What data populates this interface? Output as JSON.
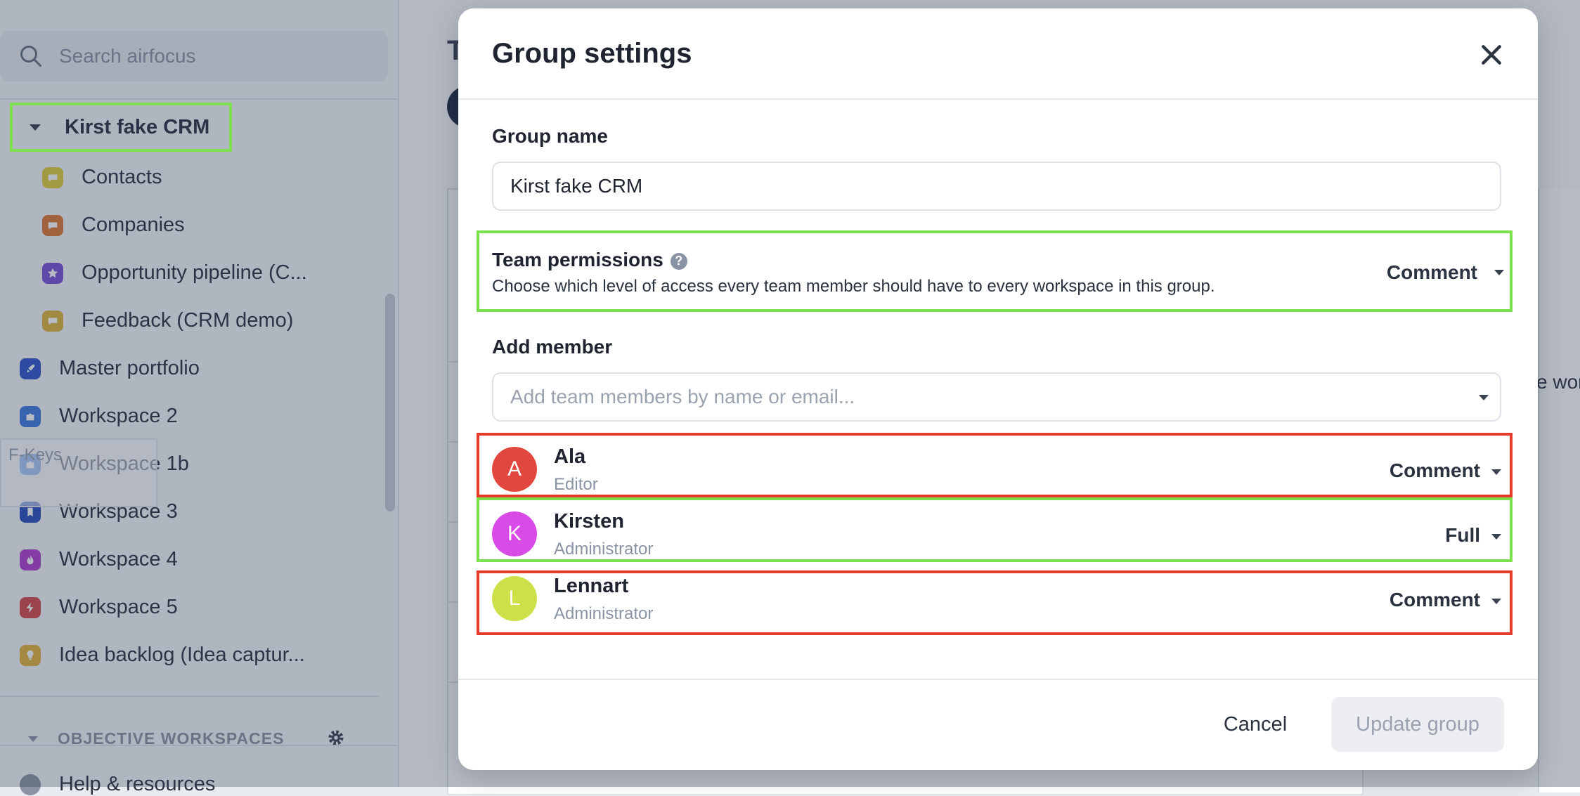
{
  "sidebar": {
    "search_placeholder": "Search airfocus",
    "group": {
      "label": "Kirst fake CRM"
    },
    "group_items": [
      {
        "label": "Contacts",
        "color": "#e3cf3a"
      },
      {
        "label": "Companies",
        "color": "#e07a35"
      },
      {
        "label": "Opportunity pipeline (C...",
        "color": "#7a52d6"
      },
      {
        "label": "Feedback (CRM demo)",
        "color": "#e0b53a"
      }
    ],
    "workspaces": [
      {
        "label": "Master portfolio",
        "color": "#2f55c9"
      },
      {
        "label": "Workspace 2",
        "color": "#3f7ae0"
      },
      {
        "label": "Workspace 1b",
        "color": "#4b8ae6"
      },
      {
        "label": "Workspace 3",
        "color": "#2a4ebd"
      },
      {
        "label": "Workspace 4",
        "color": "#b23fce"
      },
      {
        "label": "Workspace 5",
        "color": "#d6494a"
      },
      {
        "label": "Idea backlog (Idea captur...",
        "color": "#e3b43a"
      }
    ],
    "fkeys_label": "F-Keys",
    "objective_heading": "OBJECTIVE WORKSPACES",
    "help_label": "Help & resources"
  },
  "main": {
    "title_fragment": "T",
    "right_text_fragment": "e wor"
  },
  "modal": {
    "title": "Group settings",
    "group_name_label": "Group name",
    "group_name_value": "Kirst fake CRM",
    "team_permissions_label": "Team permissions",
    "help_glyph": "?",
    "team_permissions_desc": "Choose which level of access every team member should have to every workspace in this group.",
    "team_permissions_value": "Comment",
    "add_member_label": "Add member",
    "add_member_placeholder": "Add team members by name or email...",
    "members": [
      {
        "initial": "A",
        "name": "Ala",
        "role": "Editor",
        "permission": "Comment",
        "color": "#e2473f"
      },
      {
        "initial": "K",
        "name": "Kirsten",
        "role": "Administrator",
        "permission": "Full",
        "color": "#d94be6"
      },
      {
        "initial": "L",
        "name": "Lennart",
        "role": "Administrator",
        "permission": "Comment",
        "color": "#cde04a"
      }
    ],
    "cancel_label": "Cancel",
    "update_label": "Update group"
  }
}
